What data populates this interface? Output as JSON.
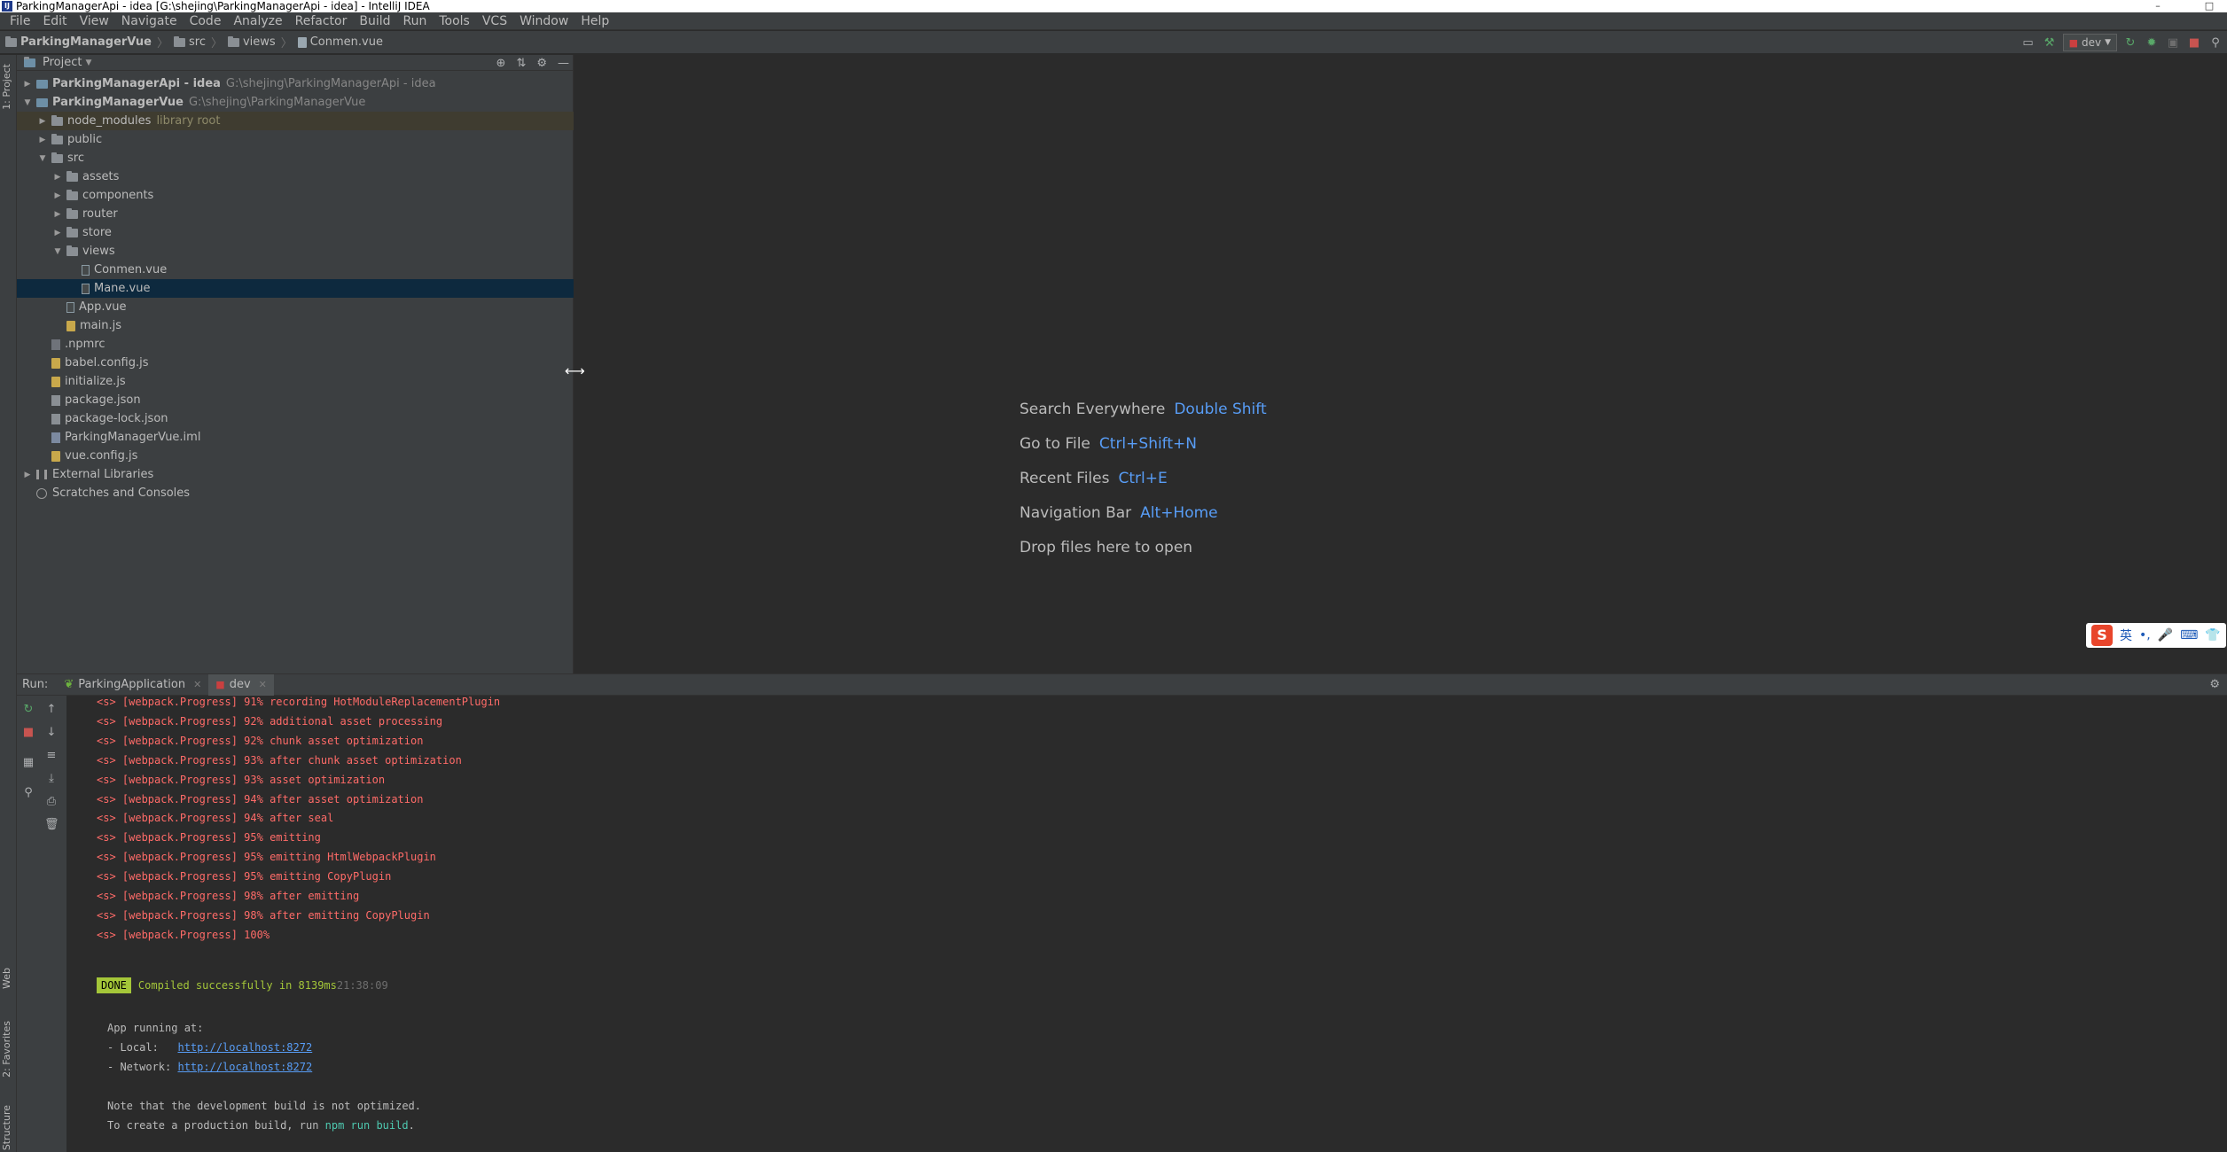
{
  "window": {
    "title": "ParkingManagerApi - idea [G:\\shejing\\ParkingManagerApi - idea] - IntelliJ IDEA",
    "app_icon": "IJ",
    "controls": [
      "–",
      "□",
      "✕"
    ]
  },
  "menu": [
    "File",
    "Edit",
    "View",
    "Navigate",
    "Code",
    "Analyze",
    "Refactor",
    "Build",
    "Run",
    "Tools",
    "VCS",
    "Window",
    "Help"
  ],
  "breadcrumb": [
    "ParkingManagerVue",
    "src",
    "views",
    "Conmen.vue"
  ],
  "run_config": {
    "label": "dev"
  },
  "left_strip": {
    "project_tab": "1: Project",
    "web_tab": "Web",
    "favorites_tab": "2: Favorites",
    "structure_tab": "Structure"
  },
  "project_panel": {
    "title": "Project",
    "tree": [
      {
        "label": "ParkingManagerApi - idea",
        "path": "G:\\shejing\\ParkingManagerApi - idea",
        "level": 0,
        "expanded": false,
        "type": "module",
        "bold": true
      },
      {
        "label": "ParkingManagerVue",
        "path": "G:\\shejing\\ParkingManagerVue",
        "level": 0,
        "expanded": true,
        "type": "module",
        "bold": true
      },
      {
        "label": "node_modules",
        "extra": "library root",
        "level": 1,
        "expanded": false,
        "type": "folder"
      },
      {
        "label": "public",
        "level": 1,
        "expanded": false,
        "type": "folder"
      },
      {
        "label": "src",
        "level": 1,
        "expanded": true,
        "type": "folder"
      },
      {
        "label": "assets",
        "level": 2,
        "expanded": false,
        "type": "folder"
      },
      {
        "label": "components",
        "level": 2,
        "expanded": false,
        "type": "folder"
      },
      {
        "label": "router",
        "level": 2,
        "expanded": false,
        "type": "folder"
      },
      {
        "label": "store",
        "level": 2,
        "expanded": false,
        "type": "folder"
      },
      {
        "label": "views",
        "level": 2,
        "expanded": true,
        "type": "folder"
      },
      {
        "label": "Conmen.vue",
        "level": 3,
        "type": "vue"
      },
      {
        "label": "Mane.vue",
        "level": 3,
        "type": "vue",
        "selected": true
      },
      {
        "label": "App.vue",
        "level": 2,
        "type": "vue"
      },
      {
        "label": "main.js",
        "level": 2,
        "type": "js"
      },
      {
        "label": ".npmrc",
        "level": 1,
        "type": "npmrc"
      },
      {
        "label": "babel.config.js",
        "level": 1,
        "type": "js"
      },
      {
        "label": "initialize.js",
        "level": 1,
        "type": "js"
      },
      {
        "label": "package.json",
        "level": 1,
        "type": "json"
      },
      {
        "label": "package-lock.json",
        "level": 1,
        "type": "json"
      },
      {
        "label": "ParkingManagerVue.iml",
        "level": 1,
        "type": "iml"
      },
      {
        "label": "vue.config.js",
        "level": 1,
        "type": "js"
      },
      {
        "label": "External Libraries",
        "level": 0,
        "expanded": false,
        "type": "lib"
      },
      {
        "label": "Scratches and Consoles",
        "level": 0,
        "type": "scratch"
      }
    ]
  },
  "editor_hints": [
    {
      "text": "Search Everywhere",
      "key": "Double Shift"
    },
    {
      "text": "Go to File",
      "key": "Ctrl+Shift+N"
    },
    {
      "text": "Recent Files",
      "key": "Ctrl+E"
    },
    {
      "text": "Navigation Bar",
      "key": "Alt+Home"
    },
    {
      "text": "Drop files here to open",
      "key": ""
    }
  ],
  "ime": {
    "logo": "S",
    "lang": "英",
    "items": [
      "•,",
      "🎤",
      "⌨",
      "👕"
    ]
  },
  "run_window": {
    "label": "Run:",
    "tabs": [
      {
        "label": "ParkingApplication",
        "active": false
      },
      {
        "label": "dev",
        "active": true
      }
    ]
  },
  "console": {
    "progress_lines": [
      "<s> [webpack.Progress] 91% recording HotModuleReplacementPlugin",
      "<s> [webpack.Progress] 92% additional asset processing",
      "<s> [webpack.Progress] 92% chunk asset optimization",
      "<s> [webpack.Progress] 93% after chunk asset optimization",
      "<s> [webpack.Progress] 93% asset optimization",
      "<s> [webpack.Progress] 94% after asset optimization",
      "<s> [webpack.Progress] 94% after seal",
      "<s> [webpack.Progress] 95% emitting",
      "<s> [webpack.Progress] 95% emitting HtmlWebpackPlugin",
      "<s> [webpack.Progress] 95% emitting CopyPlugin",
      "<s> [webpack.Progress] 98% after emitting",
      "<s> [webpack.Progress] 98% after emitting CopyPlugin",
      "<s> [webpack.Progress] 100%"
    ],
    "done_badge": "DONE",
    "done_text": "Compiled successfully in 8139ms",
    "done_time": "21:38:09",
    "app_running": "App running at:",
    "local_label": "- Local:   ",
    "local_url": "http://localhost:8272",
    "network_label": "- Network: ",
    "network_url": "http://localhost:8272",
    "note1": "Note that the development build is not optimized.",
    "note2_prefix": "To create a production build, run ",
    "note2_cmd": "npm run build",
    "note2_suffix": "."
  }
}
